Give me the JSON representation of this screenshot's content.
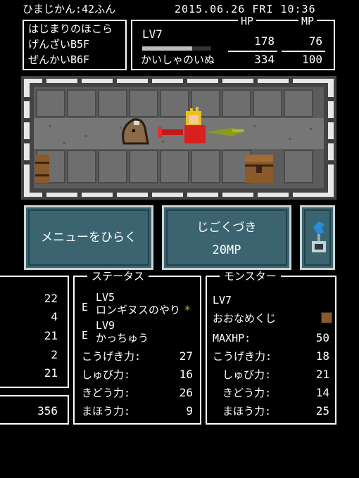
{
  "status_bar": {
    "play_time": "ひまじかん:42ふん",
    "datetime": "2015.06.26 FRI 10:36"
  },
  "location": {
    "lines": [
      "はじまりのほこら",
      "げんざいB5F",
      "ぜんかいB6F"
    ]
  },
  "party": {
    "level": "LV7",
    "hp_header": "HP",
    "mp_header": "MP",
    "exp_bar_fraction": 0.72,
    "hp_current": "178",
    "mp_current": "76",
    "name": "かいしゃのいぬ",
    "hp_max": "334",
    "mp_max": "100"
  },
  "actions": {
    "menu_label": "メニューをひらく",
    "skill_name": "じごくづき",
    "skill_cost": "20MP"
  },
  "left_stats": {
    "values": [
      "22",
      "4",
      "21",
      "2",
      "21"
    ],
    "gold": "356"
  },
  "status_panel": {
    "title": "ステータス",
    "weapon": {
      "equip_mark": "E",
      "level": "LV5",
      "name": "ロンギヌスのやり"
    },
    "armor": {
      "equip_mark": "E",
      "level": "LV9",
      "name": "かっちゅう"
    },
    "stats": [
      {
        "label": "こうげき力:",
        "value": "27"
      },
      {
        "label": "しゅび力:",
        "value": "16"
      },
      {
        "label": "きどう力:",
        "value": "26"
      },
      {
        "label": "まほう力:",
        "value": "9"
      }
    ]
  },
  "monster_panel": {
    "title": "モンスター",
    "level": "LV7",
    "name": "おおなめくじ",
    "stats": [
      {
        "label": "MAXHP:",
        "value": "50"
      },
      {
        "label": "こうげき力:",
        "value": "18"
      },
      {
        "label": "しゅび力:",
        "value": "21"
      },
      {
        "label": "きどう力:",
        "value": "14"
      },
      {
        "label": "まほう力:",
        "value": "25"
      }
    ]
  },
  "colors": {
    "button_bg": "#3b6470",
    "floor": "#6d6d6d",
    "wall": "#5a5a5a"
  }
}
